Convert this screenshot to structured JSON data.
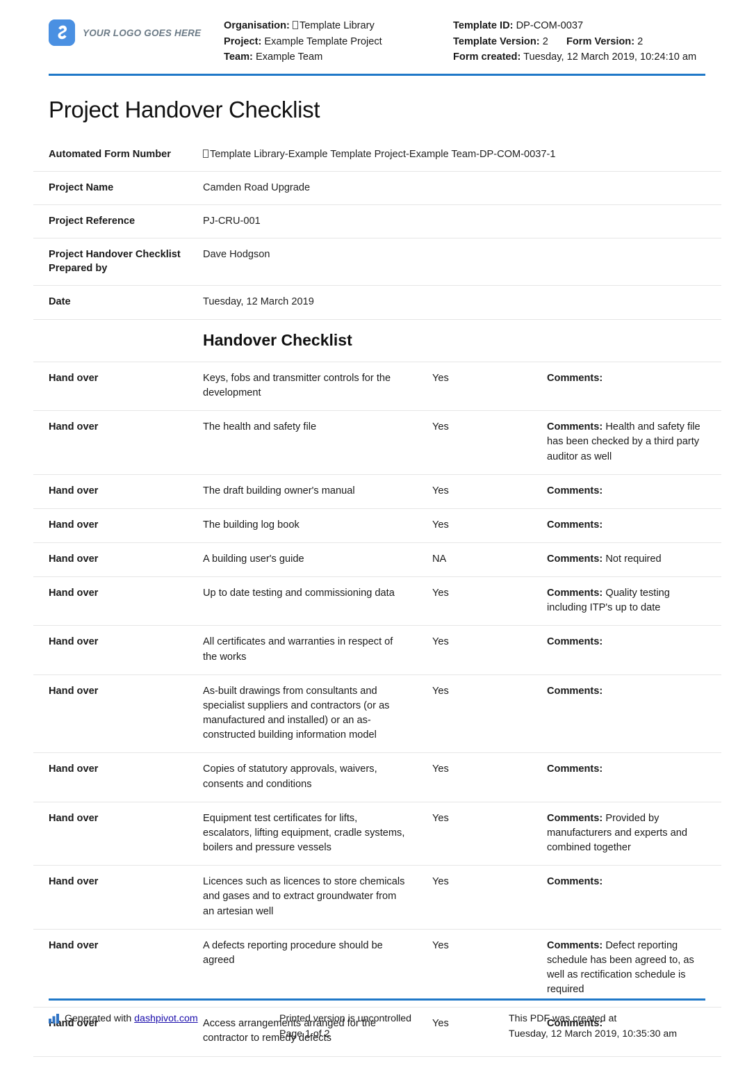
{
  "header": {
    "logo_text": "YOUR LOGO GOES HERE",
    "logo_icon": "dashpivot-logo-icon",
    "organisation_label": "Organisation:",
    "organisation_value": "Template Library",
    "project_label": "Project:",
    "project_value": "Example Template Project",
    "team_label": "Team:",
    "team_value": "Example Team",
    "template_id_label": "Template ID:",
    "template_id_value": "DP-COM-0037",
    "template_version_label": "Template Version:",
    "template_version_value": "2",
    "form_version_label": "Form Version:",
    "form_version_value": "2",
    "form_created_label": "Form created:",
    "form_created_value": "Tuesday, 12 March 2019, 10:24:10 am",
    "rule_color": "#1f78c8"
  },
  "title": "Project Handover Checklist",
  "info_rows": [
    {
      "label": "Automated Form Number",
      "value": "Template Library-Example Template Project-Example Team-DP-COM-0037-1",
      "has_tofu": true
    },
    {
      "label": "Project Name",
      "value": "Camden Road Upgrade",
      "has_tofu": false
    },
    {
      "label": "Project Reference",
      "value": "PJ-CRU-001",
      "has_tofu": false
    },
    {
      "label": "Project Handover Checklist Prepared by",
      "value": "Dave Hodgson",
      "has_tofu": false
    },
    {
      "label": "Date",
      "value": "Tuesday, 12 March 2019",
      "has_tofu": false
    }
  ],
  "section_heading": "Handover Checklist",
  "comments_label": "Comments:",
  "checklist_rows": [
    {
      "label": "Hand over",
      "description": "Keys, fobs and transmitter controls for the development",
      "status": "Yes",
      "comment": ""
    },
    {
      "label": "Hand over",
      "description": "The health and safety file",
      "status": "Yes",
      "comment": "Health and safety file has been checked by a third party auditor as well"
    },
    {
      "label": "Hand over",
      "description": "The draft building owner's manual",
      "status": "Yes",
      "comment": ""
    },
    {
      "label": "Hand over",
      "description": "The building log book",
      "status": "Yes",
      "comment": ""
    },
    {
      "label": "Hand over",
      "description": "A building user's guide",
      "status": "NA",
      "comment": "Not required"
    },
    {
      "label": "Hand over",
      "description": "Up to date testing and commissioning data",
      "status": "Yes",
      "comment": "Quality testing including ITP's up to date"
    },
    {
      "label": "Hand over",
      "description": "All certificates and warranties in respect of the works",
      "status": "Yes",
      "comment": ""
    },
    {
      "label": "Hand over",
      "description": "As-built drawings from consultants and specialist suppliers and contractors (or as manufactured and installed) or an as-constructed building information model",
      "status": "Yes",
      "comment": ""
    },
    {
      "label": "Hand over",
      "description": "Copies of statutory approvals, waivers, consents and conditions",
      "status": "Yes",
      "comment": ""
    },
    {
      "label": "Hand over",
      "description": "Equipment test certificates for lifts, escalators, lifting equipment, cradle systems, boilers and pressure vessels",
      "status": "Yes",
      "comment": "Provided by manufacturers and experts and combined together"
    },
    {
      "label": "Hand over",
      "description": "Licences such as licences to store chemicals and gases and to extract groundwater from an artesian well",
      "status": "Yes",
      "comment": ""
    },
    {
      "label": "Hand over",
      "description": "A defects reporting procedure should be agreed",
      "status": "Yes",
      "comment": "Defect reporting schedule has been agreed to, as well as rectification schedule is required"
    },
    {
      "label": "Hand over",
      "description": "Access arrangements arranged for the contractor to remedy defects",
      "status": "Yes",
      "comment": ""
    }
  ],
  "footer": {
    "icon": "bar-chart-icon",
    "generated_prefix": "Generated with",
    "generated_link": "dashpivot.com",
    "printed_line1": "Printed version is uncontrolled",
    "printed_line2": "Page 1 of 2",
    "created_line1": "This PDF was created at",
    "created_line2": "Tuesday, 12 March 2019, 10:35:30 am",
    "link_color": "#1a0dab"
  }
}
